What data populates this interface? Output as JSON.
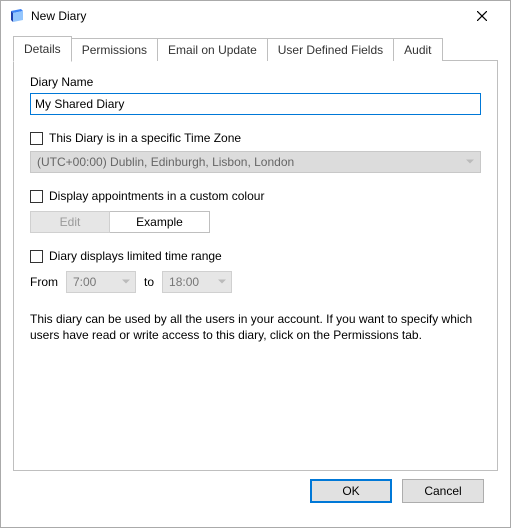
{
  "window": {
    "title": "New Diary"
  },
  "tabs": {
    "t0": "Details",
    "t1": "Permissions",
    "t2": "Email on Update",
    "t3": "User Defined Fields",
    "t4": "Audit"
  },
  "details": {
    "name_label": "Diary Name",
    "name_value": "My Shared Diary",
    "tz_label": "This Diary is in a specific Time Zone",
    "tz_value": "(UTC+00:00) Dublin, Edinburgh, Lisbon, London",
    "colour_label": "Display appointments in a custom colour",
    "edit_btn": "Edit",
    "example_label": "Example",
    "range_label": "Diary displays limited time range",
    "from_label": "From",
    "to_label": "to",
    "from_value": "7:00",
    "to_value": "18:00",
    "help": "This diary can be used by all the users in your account. If you want to specify which users have read or write access to this diary, click on the Permissions tab."
  },
  "footer": {
    "ok": "OK",
    "cancel": "Cancel"
  }
}
